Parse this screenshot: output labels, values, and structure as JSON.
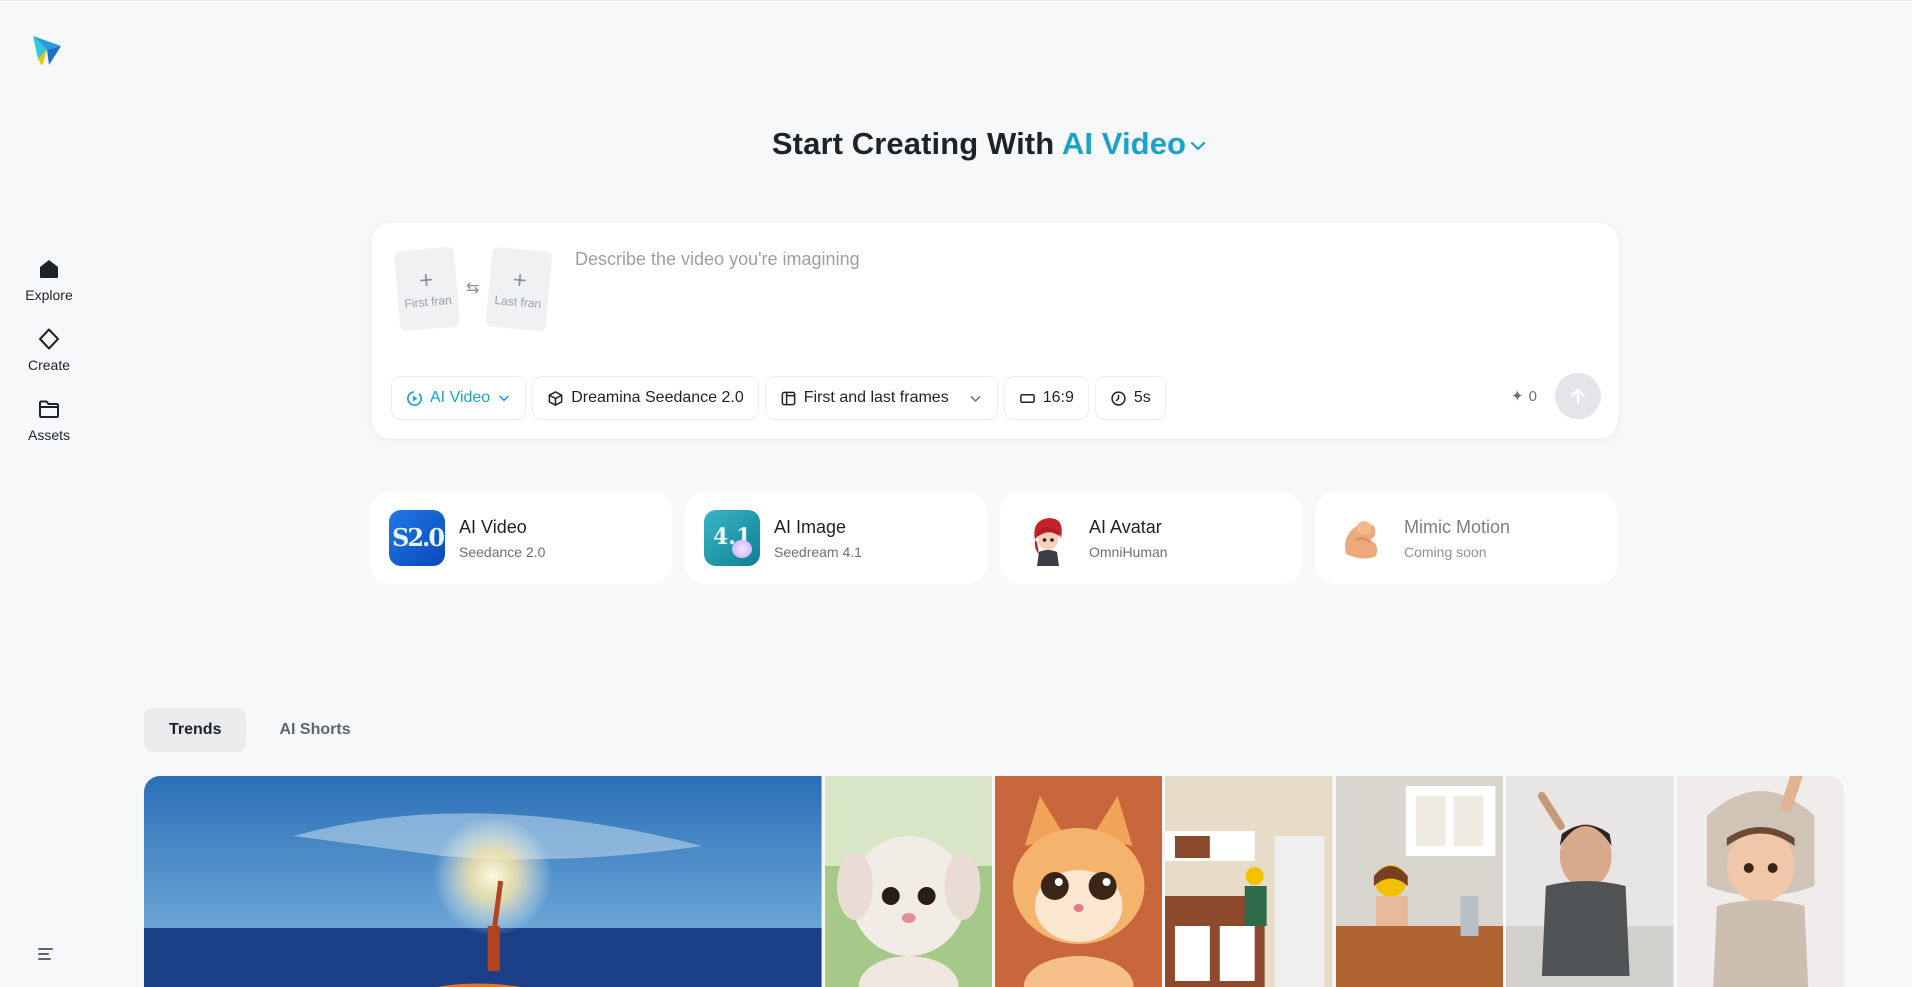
{
  "nav": {
    "items": [
      {
        "label": "Explore",
        "icon": "home-icon"
      },
      {
        "label": "Create",
        "icon": "diamond-icon"
      },
      {
        "label": "Assets",
        "icon": "folder-icon"
      }
    ]
  },
  "heading": {
    "prefix": "Start Creating With",
    "mode": "AI Video"
  },
  "prompt": {
    "placeholder": "Describe the video you're imagining",
    "first_frame_label": "First fran",
    "last_frame_label": "Last fran",
    "credits": "0"
  },
  "toolbar": {
    "mode": "AI Video",
    "model": "Dreamina Seedance 2.0",
    "frames": "First and last frames",
    "ratio": "16:9",
    "duration": "5s"
  },
  "features": [
    {
      "title": "AI Video",
      "subtitle": "Seedance 2.0",
      "badge": "S2.0"
    },
    {
      "title": "AI Image",
      "subtitle": "Seedream 4.1",
      "badge": "4.1"
    },
    {
      "title": "AI Avatar",
      "subtitle": "OmniHuman"
    },
    {
      "title": "Mimic Motion",
      "subtitle": "Coming soon"
    }
  ],
  "tabs": [
    {
      "label": "Trends",
      "active": true
    },
    {
      "label": "AI Shorts",
      "active": false
    }
  ],
  "colors": {
    "accent": "#1aa3c8",
    "background": "#f7f8fa"
  }
}
